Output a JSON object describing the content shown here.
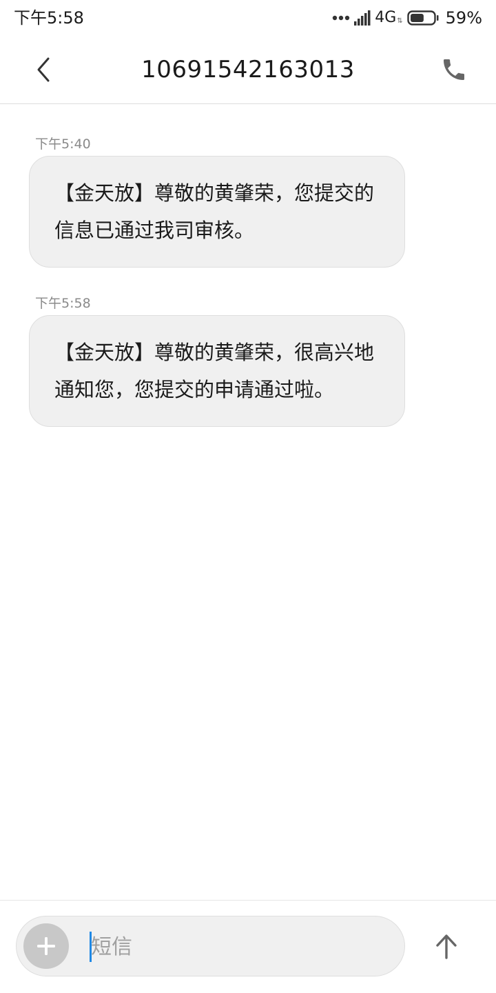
{
  "status_bar": {
    "time": "下午5:58",
    "network": "4G",
    "network_arrows": "⇅",
    "battery_pct": "59%",
    "battery_level": 0.59
  },
  "header": {
    "title": "10691542163013",
    "back_icon": "chevron-left-icon",
    "call_icon": "phone-icon"
  },
  "messages": [
    {
      "time": "下午5:40",
      "text": "【金天放】尊敬的黄肇荣，您提交的信息已通过我司审核。"
    },
    {
      "time": "下午5:58",
      "text": "【金天放】尊敬的黄肇荣，很高兴地通知您，您提交的申请通过啦。"
    }
  ],
  "composer": {
    "placeholder": "短信",
    "value": "",
    "attach_icon": "plus-icon",
    "send_icon": "arrow-up-icon"
  },
  "colors": {
    "bubble_bg": "#f0f0f0",
    "caret": "#1e88e5",
    "icon_gray": "#666666"
  }
}
